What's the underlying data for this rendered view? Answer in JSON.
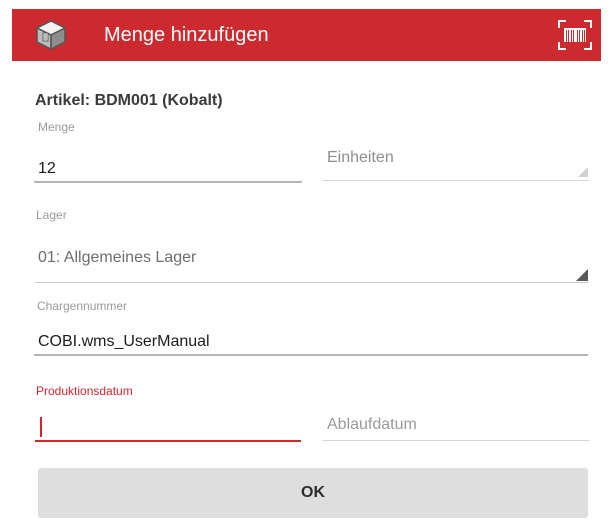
{
  "header": {
    "title": "Menge hinzufügen",
    "color": "#cc2a2f",
    "app_icon": "box-app-icon",
    "scan_icon": "barcode-scan-icon"
  },
  "article": {
    "label": "Artikel: BDM001 (Kobalt)"
  },
  "quantity": {
    "label": "Menge",
    "value": "12"
  },
  "unit": {
    "placeholder": "Einheiten"
  },
  "warehouse": {
    "label": "Lager",
    "value": "01: Allgemeines Lager"
  },
  "batch": {
    "label": "Chargennummer",
    "value": "COBI.wms_UserManual"
  },
  "production_date": {
    "label": "Produktionsdatum",
    "value": ""
  },
  "expiry_date": {
    "placeholder": "Ablaufdatum"
  },
  "ok_button": {
    "label": "OK"
  }
}
